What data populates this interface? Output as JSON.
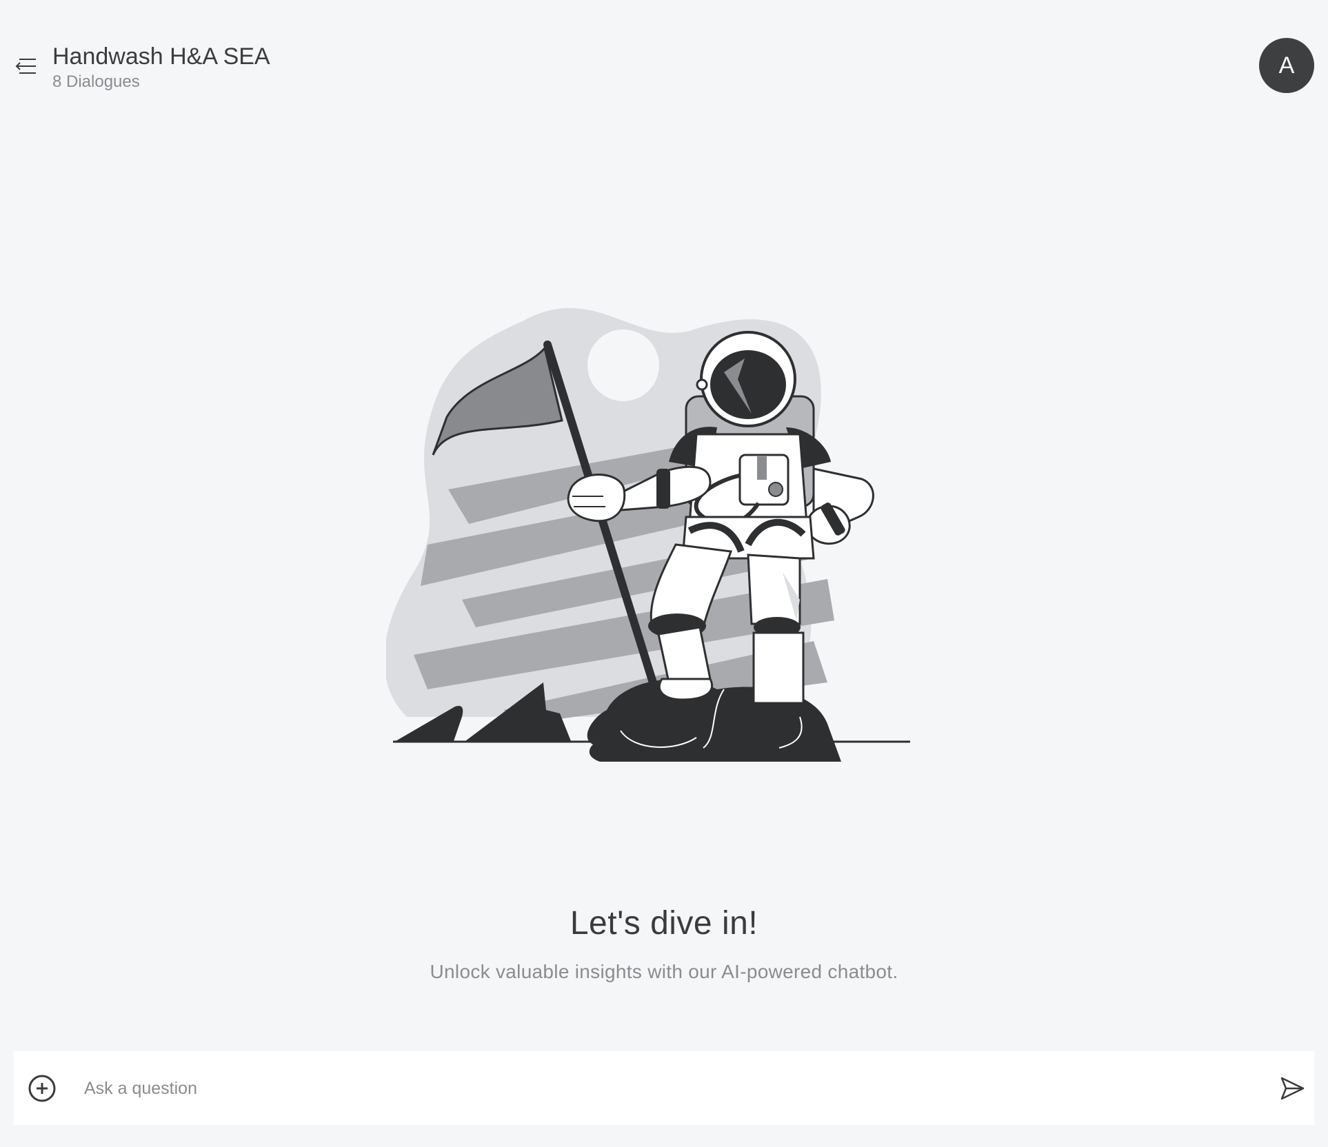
{
  "header": {
    "title": "Handwash H&A SEA",
    "subtitle": "8 Dialogues",
    "avatar_initial": "A"
  },
  "welcome": {
    "headline": "Let's dive in!",
    "tagline": "Unlock valuable insights with our AI-powered chatbot."
  },
  "composer": {
    "placeholder": "Ask a question",
    "value": ""
  },
  "icons": {
    "menu": "menu-collapse-icon",
    "add": "plus-circle-icon",
    "send": "send-icon"
  },
  "colors": {
    "background": "#f5f6f8",
    "avatar": "#3e3f41",
    "text_primary": "#3a3b3d",
    "text_secondary": "#8a8c90"
  }
}
